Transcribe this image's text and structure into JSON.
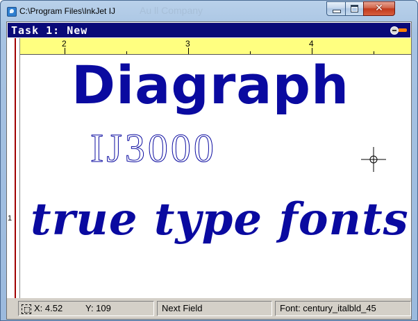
{
  "window": {
    "title": "C:\\Program Files\\InkJet  IJ",
    "background_title": "Au ll  Company"
  },
  "task": {
    "title": "Task 1: New"
  },
  "ruler": {
    "labels": [
      "2",
      "3",
      "4"
    ],
    "vertical_label": "1",
    "background_color": "#ffff80"
  },
  "canvas": {
    "lines": [
      "Diagraph",
      "IJ3000",
      "true type fonts"
    ],
    "text_color": "#0a0aa0"
  },
  "status": {
    "x_label": "X: 4.52",
    "y_label": "Y: 109",
    "field": "Next Field",
    "font": "Font: century_italbld_45"
  },
  "icons": [
    "app-icon",
    "minimize-icon",
    "maximize-icon",
    "close-icon",
    "toggle-icon",
    "crosshair-icon",
    "selection-icon"
  ]
}
